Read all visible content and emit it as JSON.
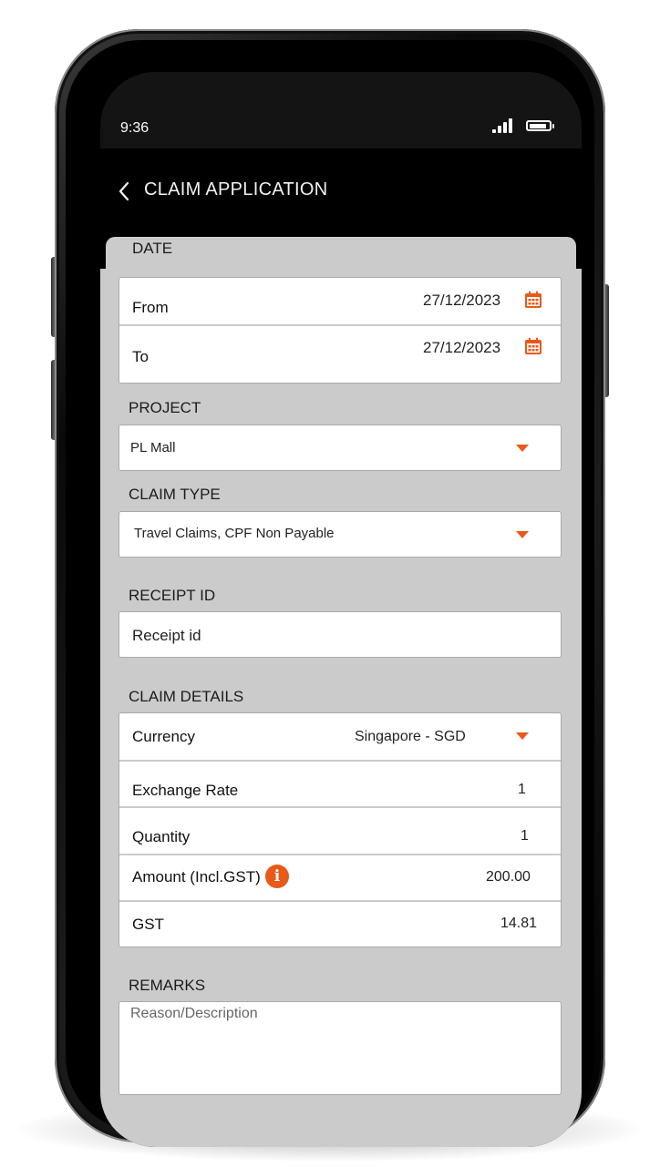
{
  "status_bar": {
    "time": "9:36"
  },
  "header": {
    "title": "CLAIM APPLICATION"
  },
  "date_section": {
    "label": "DATE",
    "from_label": "From",
    "from_value": "27/12/2023",
    "to_label": "To",
    "to_value": "27/12/2023"
  },
  "project": {
    "label": "PROJECT",
    "value": "PL Mall"
  },
  "claim_type": {
    "label": "CLAIM TYPE",
    "value": "Travel Claims, CPF Non Payable"
  },
  "receipt": {
    "label": "RECEIPT ID",
    "placeholder": "Receipt id"
  },
  "claim_details": {
    "label": "CLAIM DETAILS",
    "currency_label": "Currency",
    "currency_value": "Singapore - SGD",
    "exchange_rate_label": "Exchange Rate",
    "exchange_rate_value": "1",
    "quantity_label": "Quantity",
    "quantity_value": "1",
    "amount_label": "Amount (Incl.GST)",
    "amount_value": "200.00",
    "gst_label": "GST",
    "gst_value": "14.81"
  },
  "remarks": {
    "label": "REMARKS",
    "placeholder": "Reason/Description"
  },
  "colors": {
    "accent": "#e8591a",
    "content_bg": "#cbcbcb",
    "header_bg": "#000000"
  },
  "icons": {
    "back": "chevron-left-icon",
    "calendar": "calendar-icon",
    "dropdown": "caret-down-icon",
    "info": "info-icon"
  }
}
